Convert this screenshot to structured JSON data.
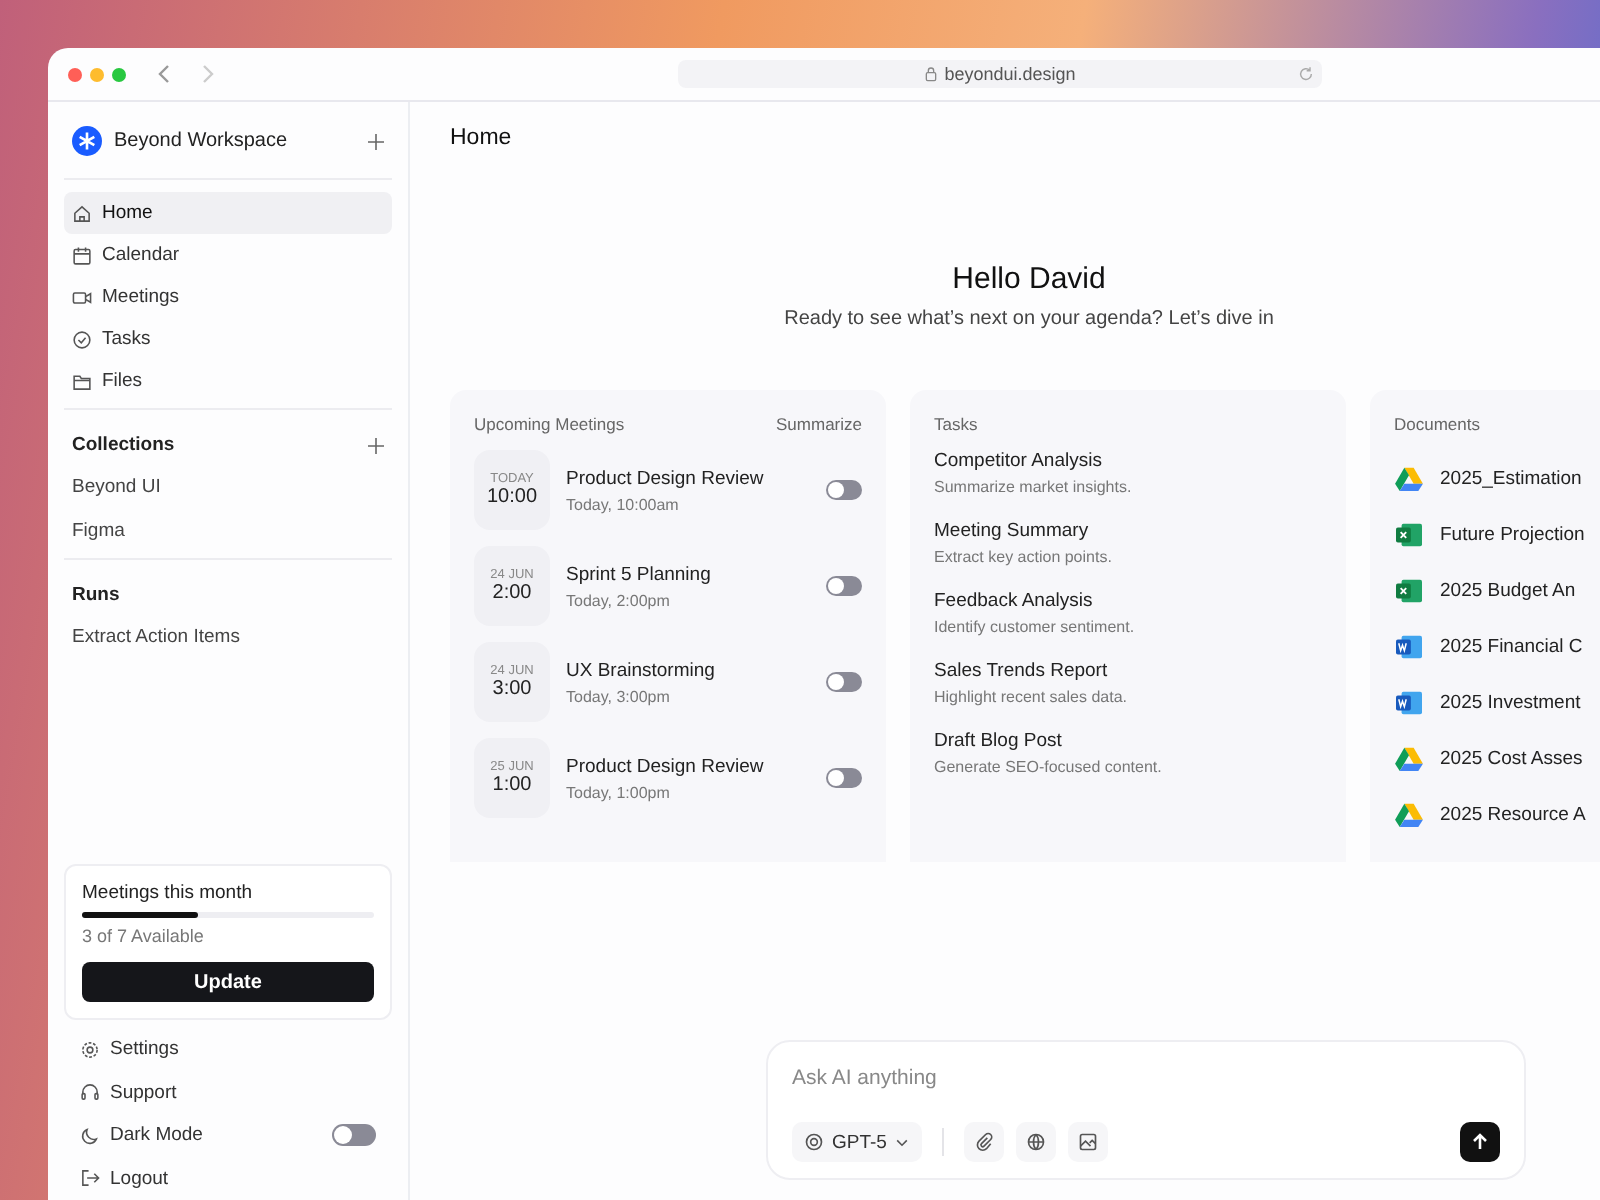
{
  "browser": {
    "url": "beyondui.design"
  },
  "sidebar": {
    "workspace": "Beyond Workspace",
    "nav": [
      {
        "label": "Home",
        "selected": true
      },
      {
        "label": "Calendar",
        "selected": false
      },
      {
        "label": "Meetings",
        "selected": false
      },
      {
        "label": "Tasks",
        "selected": false
      },
      {
        "label": "Files",
        "selected": false
      }
    ],
    "collections": {
      "title": "Collections",
      "items": [
        "Beyond UI",
        "Figma"
      ]
    },
    "runs": {
      "title": "Runs",
      "items": [
        "Extract Action Items"
      ]
    },
    "usage": {
      "title": "Meetings this month",
      "level": 0.4,
      "caption": "3 of 7 Available",
      "button": "Update"
    },
    "footer": [
      {
        "label": "Settings",
        "kind": "link"
      },
      {
        "label": "Support",
        "kind": "link"
      },
      {
        "label": "Dark Mode",
        "kind": "toggle",
        "on": false
      },
      {
        "label": "Logout",
        "kind": "link"
      }
    ]
  },
  "page": {
    "title": "Home",
    "greeting": "Hello David",
    "subtitle": "Ready to see what’s next on your agenda? Let’s dive in"
  },
  "meetings": {
    "title": "Upcoming Meetings",
    "action": "Summarize",
    "items": [
      {
        "date": "TODAY",
        "time": "10:00",
        "name": "Product Design Review",
        "when": "Today, 10:00am",
        "on": false
      },
      {
        "date": "24 JUN",
        "time": "2:00",
        "name": "Sprint 5 Planning",
        "when": "Today, 2:00pm",
        "on": false
      },
      {
        "date": "24 JUN",
        "time": "3:00",
        "name": "UX Brainstorming",
        "when": "Today, 3:00pm",
        "on": false
      },
      {
        "date": "25 JUN",
        "time": "1:00",
        "name": "Product Design Review",
        "when": "Today, 1:00pm",
        "on": false
      }
    ]
  },
  "tasks": {
    "title": "Tasks",
    "items": [
      {
        "name": "Competitor Analysis",
        "desc": "Summarize market insights."
      },
      {
        "name": "Meeting Summary",
        "desc": "Extract key action points."
      },
      {
        "name": "Feedback Analysis",
        "desc": "Identify customer sentiment."
      },
      {
        "name": "Sales Trends Report",
        "desc": "Highlight recent sales data."
      },
      {
        "name": "Draft Blog Post",
        "desc": "Generate SEO-focused content."
      }
    ]
  },
  "documents": {
    "title": "Documents",
    "items": [
      {
        "name": "2025_Estimation",
        "kind": "drive"
      },
      {
        "name": "Future Projection",
        "kind": "sheet"
      },
      {
        "name": "2025 Budget An",
        "kind": "sheet"
      },
      {
        "name": "2025 Financial C",
        "kind": "doc"
      },
      {
        "name": "2025 Investment",
        "kind": "doc"
      },
      {
        "name": "2025 Cost Asses",
        "kind": "drive"
      },
      {
        "name": "2025 Resource A",
        "kind": "drive"
      }
    ]
  },
  "composer": {
    "placeholder": "Ask AI anything",
    "model": "GPT-5"
  }
}
